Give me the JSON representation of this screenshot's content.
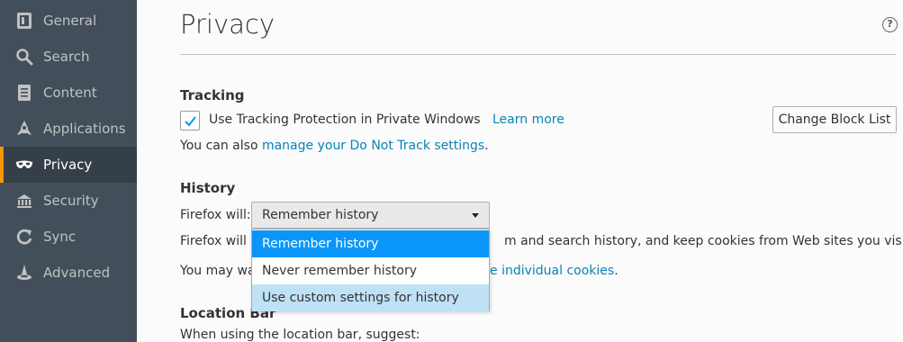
{
  "sidebar": {
    "items": [
      {
        "label": "General",
        "icon": "general-icon"
      },
      {
        "label": "Search",
        "icon": "search-icon"
      },
      {
        "label": "Content",
        "icon": "content-icon"
      },
      {
        "label": "Applications",
        "icon": "applications-icon"
      },
      {
        "label": "Privacy",
        "icon": "privacy-mask-icon",
        "active": true
      },
      {
        "label": "Security",
        "icon": "security-icon"
      },
      {
        "label": "Sync",
        "icon": "sync-icon"
      },
      {
        "label": "Advanced",
        "icon": "advanced-icon"
      }
    ]
  },
  "page": {
    "title": "Privacy",
    "help": "?"
  },
  "tracking": {
    "title": "Tracking",
    "checkbox_label": "Use Tracking Protection in Private Windows",
    "checked": true,
    "learn_more": "Learn more",
    "change_block_list": "Change Block List",
    "dnt_prefix": "You can also ",
    "dnt_link": "manage your Do Not Track settings",
    "dnt_suffix": "."
  },
  "history": {
    "title": "History",
    "will_label": "Firefox will:",
    "selected": "Remember history",
    "options": [
      "Remember history",
      "Never remember history",
      "Use custom settings for history"
    ],
    "desc_left": "Firefox will r",
    "desc_right": "m and search history, and keep cookies from Web sites you visit.",
    "may_left": "You may wa",
    "may_link": "e individual cookies",
    "may_suffix": "."
  },
  "location_bar": {
    "title": "Location Bar",
    "desc": "When using the location bar, suggest:"
  },
  "colors": {
    "sidebar_bg": "#424f5a",
    "sidebar_active_bg": "#343f48",
    "accent": "#ff9500",
    "link": "#0a84b5",
    "highlight": "#0996f8"
  }
}
